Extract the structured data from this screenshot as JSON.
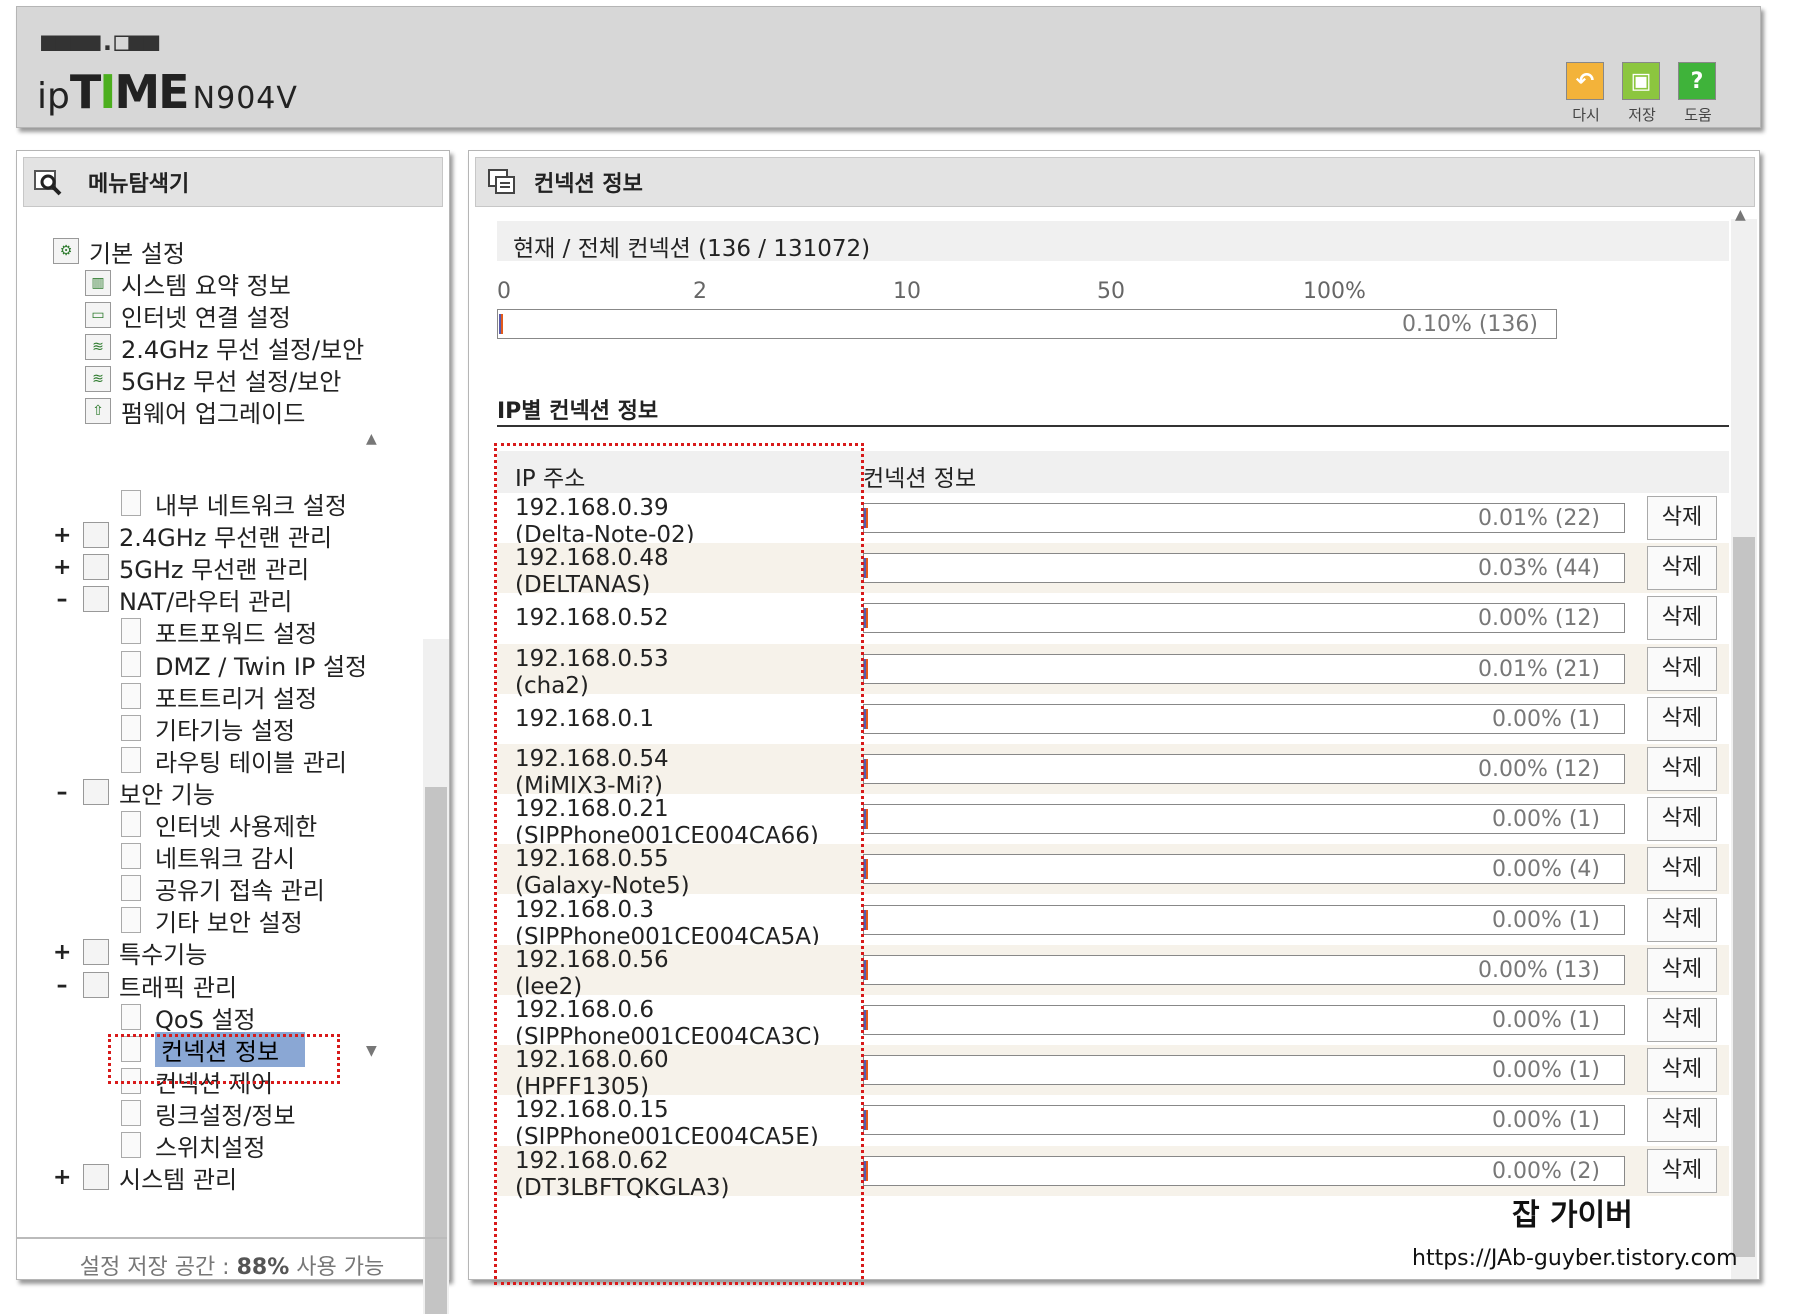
{
  "header": {
    "logo_dots": "■■■■.□■■",
    "logo_ip": "ip",
    "logo_time_1": "T",
    "logo_time_2": "I",
    "logo_time_3": "ME",
    "model": "N904V",
    "buttons": [
      {
        "label": "다시",
        "icon": "undo-icon",
        "glyph": "↶",
        "color": "#f3b33a"
      },
      {
        "label": "저장",
        "icon": "save-icon",
        "glyph": "▣",
        "color": "#8cc63f"
      },
      {
        "label": "도움",
        "icon": "help-icon",
        "glyph": "?",
        "color": "#3fb33a"
      }
    ]
  },
  "sidebar": {
    "title": "메뉴탐색기",
    "top_tree": [
      {
        "label": "기본 설정",
        "icon": "folder-gear-icon"
      },
      {
        "label": "시스템 요약 정보",
        "icon": "chart-icon"
      },
      {
        "label": "인터넷 연결 설정",
        "icon": "monitor-icon"
      },
      {
        "label": "2.4GHz 무선 설정/보안",
        "icon": "wireless-icon"
      },
      {
        "label": "5GHz 무선 설정/보안",
        "icon": "wireless-icon"
      },
      {
        "label": "펌웨어 업그레이드",
        "icon": "upgrade-icon"
      }
    ],
    "tree": [
      {
        "label": "내부 네트워크 설정",
        "type": "page"
      },
      {
        "label": "2.4GHz 무선랜 관리",
        "type": "group",
        "pm": "+"
      },
      {
        "label": "5GHz 무선랜 관리",
        "type": "group",
        "pm": "+"
      },
      {
        "label": "NAT/라우터 관리",
        "type": "group",
        "pm": "–"
      },
      {
        "label": "포트포워드 설정",
        "type": "page"
      },
      {
        "label": "DMZ / Twin IP 설정",
        "type": "page"
      },
      {
        "label": "포트트리거 설정",
        "type": "page"
      },
      {
        "label": "기타기능 설정",
        "type": "page"
      },
      {
        "label": "라우팅 테이블 관리",
        "type": "page"
      },
      {
        "label": "보안 기능",
        "type": "group",
        "pm": "–"
      },
      {
        "label": "인터넷 사용제한",
        "type": "page"
      },
      {
        "label": "네트워크 감시",
        "type": "page"
      },
      {
        "label": "공유기 접속 관리",
        "type": "page"
      },
      {
        "label": "기타 보안 설정",
        "type": "page"
      },
      {
        "label": "특수기능",
        "type": "group",
        "pm": "+"
      },
      {
        "label": "트래픽 관리",
        "type": "group",
        "pm": "–"
      },
      {
        "label": "QoS 설정",
        "type": "page"
      },
      {
        "label": "컨넥션 정보",
        "type": "page",
        "selected": true
      },
      {
        "label": "컨넥션 제어",
        "type": "page"
      },
      {
        "label": "링크설정/정보",
        "type": "page"
      },
      {
        "label": "스위치설정",
        "type": "page"
      },
      {
        "label": "시스템 관리",
        "type": "group",
        "pm": "+"
      }
    ],
    "storage_prefix": "설정 저장 공간 : ",
    "storage_pct": "88%",
    "storage_suffix": " 사용 가능"
  },
  "main": {
    "title": "컨넥션 정보",
    "summary": "현재 / 전체 컨넥션 (136 / 131072)",
    "scale": [
      "0",
      "2",
      "10",
      "50",
      "100%"
    ],
    "total_pct": "0.10% (136)",
    "total_fraction": 0.001,
    "section_title": "IP별 컨넥션 정보",
    "col_ip": "IP 주소",
    "col_conn": "컨넥션 정보",
    "delete_label": "삭제",
    "rows": [
      {
        "ip": "192.168.0.39",
        "name": "(Delta-Note-02)",
        "pct": "0.01% (22)"
      },
      {
        "ip": "192.168.0.48",
        "name": "(DELTANAS)",
        "pct": "0.03% (44)"
      },
      {
        "ip": "192.168.0.52",
        "name": "",
        "pct": "0.00% (12)"
      },
      {
        "ip": "192.168.0.53",
        "name": "(cha2)",
        "pct": "0.01% (21)"
      },
      {
        "ip": "192.168.0.1",
        "name": "",
        "pct": "0.00% (1)"
      },
      {
        "ip": "192.168.0.54",
        "name": "(MiMIX3-Mi?)",
        "pct": "0.00% (12)"
      },
      {
        "ip": "192.168.0.21",
        "name": "(SIPPhone001CE004CA66)",
        "pct": "0.00% (1)"
      },
      {
        "ip": "192.168.0.55",
        "name": "(Galaxy-Note5)",
        "pct": "0.00% (4)"
      },
      {
        "ip": "192.168.0.3",
        "name": "(SIPPhone001CE004CA5A)",
        "pct": "0.00% (1)"
      },
      {
        "ip": "192.168.0.56",
        "name": "(lee2)",
        "pct": "0.00% (13)"
      },
      {
        "ip": "192.168.0.6",
        "name": "(SIPPhone001CE004CA3C)",
        "pct": "0.00% (1)"
      },
      {
        "ip": "192.168.0.60",
        "name": "(HPFF1305)",
        "pct": "0.00% (1)"
      },
      {
        "ip": "192.168.0.15",
        "name": "(SIPPhone001CE004CA5E)",
        "pct": "0.00% (1)"
      },
      {
        "ip": "192.168.0.62",
        "name": "(DT3LBFTQKGLA3)",
        "pct": "0.00% (2)"
      }
    ]
  },
  "watermark": {
    "title": "잡 가이버",
    "url": "https://JAb-guyber.tistory.com"
  }
}
